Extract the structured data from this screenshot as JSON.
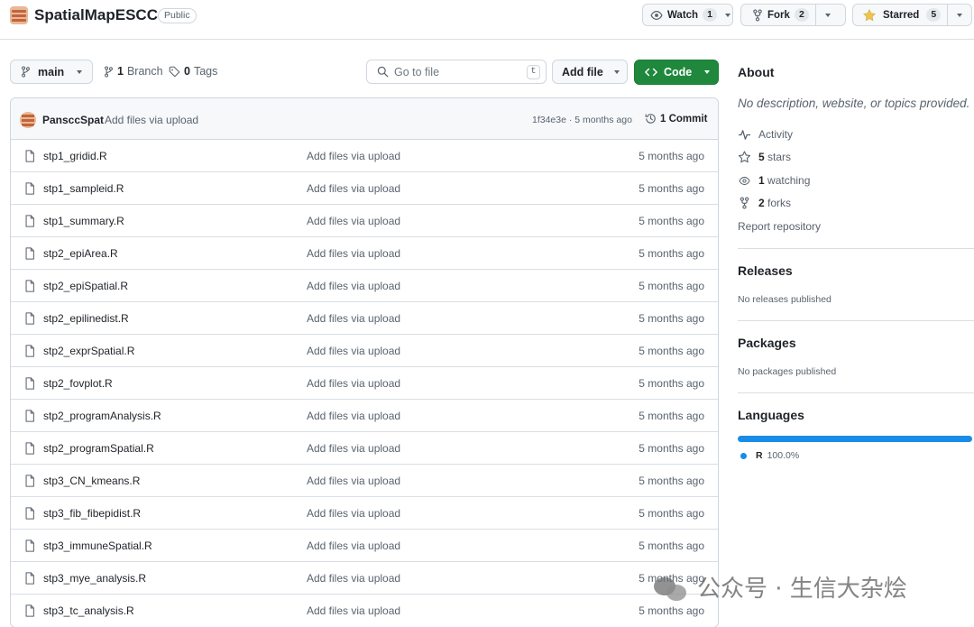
{
  "header": {
    "repo_name": "SpatialMapESCC",
    "visibility": "Public",
    "watch": {
      "label": "Watch",
      "count": "1"
    },
    "fork": {
      "label": "Fork",
      "count": "2"
    },
    "star": {
      "label": "Starred",
      "count": "5"
    }
  },
  "toolbar": {
    "branch": "main",
    "branches_count": "1",
    "branches_label": "Branch",
    "tags_count": "0",
    "tags_label": "Tags",
    "search_placeholder": "Go to file",
    "search_kbd": "t",
    "add_file": "Add file",
    "code": "Code"
  },
  "commit": {
    "author": "PansccSpat",
    "message": "Add files via upload",
    "meta": "1f34e3e · 5 months ago",
    "count_label": "1 Commit"
  },
  "files": [
    {
      "name": "stp1_gridid.R",
      "commit": "Add files via upload",
      "age": "5 months ago"
    },
    {
      "name": "stp1_sampleid.R",
      "commit": "Add files via upload",
      "age": "5 months ago"
    },
    {
      "name": "stp1_summary.R",
      "commit": "Add files via upload",
      "age": "5 months ago"
    },
    {
      "name": "stp2_epiArea.R",
      "commit": "Add files via upload",
      "age": "5 months ago"
    },
    {
      "name": "stp2_epiSpatial.R",
      "commit": "Add files via upload",
      "age": "5 months ago"
    },
    {
      "name": "stp2_epilinedist.R",
      "commit": "Add files via upload",
      "age": "5 months ago"
    },
    {
      "name": "stp2_exprSpatial.R",
      "commit": "Add files via upload",
      "age": "5 months ago"
    },
    {
      "name": "stp2_fovplot.R",
      "commit": "Add files via upload",
      "age": "5 months ago"
    },
    {
      "name": "stp2_programAnalysis.R",
      "commit": "Add files via upload",
      "age": "5 months ago"
    },
    {
      "name": "stp2_programSpatial.R",
      "commit": "Add files via upload",
      "age": "5 months ago"
    },
    {
      "name": "stp3_CN_kmeans.R",
      "commit": "Add files via upload",
      "age": "5 months ago"
    },
    {
      "name": "stp3_fib_fibepidist.R",
      "commit": "Add files via upload",
      "age": "5 months ago"
    },
    {
      "name": "stp3_immuneSpatial.R",
      "commit": "Add files via upload",
      "age": "5 months ago"
    },
    {
      "name": "stp3_mye_analysis.R",
      "commit": "Add files via upload",
      "age": "5 months ago"
    },
    {
      "name": "stp3_tc_analysis.R",
      "commit": "Add files via upload",
      "age": "5 months ago"
    }
  ],
  "about": {
    "title": "About",
    "description": "No description, website, or topics provided.",
    "activity": "Activity",
    "stars_count": "5",
    "stars_label": "stars",
    "watching_count": "1",
    "watching_label": "watching",
    "forks_count": "2",
    "forks_label": "forks",
    "report": "Report repository"
  },
  "releases": {
    "title": "Releases",
    "note": "No releases published"
  },
  "packages": {
    "title": "Packages",
    "note": "No packages published"
  },
  "languages": {
    "title": "Languages",
    "items": [
      {
        "name": "R",
        "percent": "100.0%",
        "color": "#198ce7",
        "fraction": 1.0
      }
    ]
  },
  "watermark": "公众号 · 生信大杂烩",
  "colors": {
    "accent_green": "#1f883d",
    "star_yellow": "#eac54f",
    "muted": "#59636e"
  }
}
